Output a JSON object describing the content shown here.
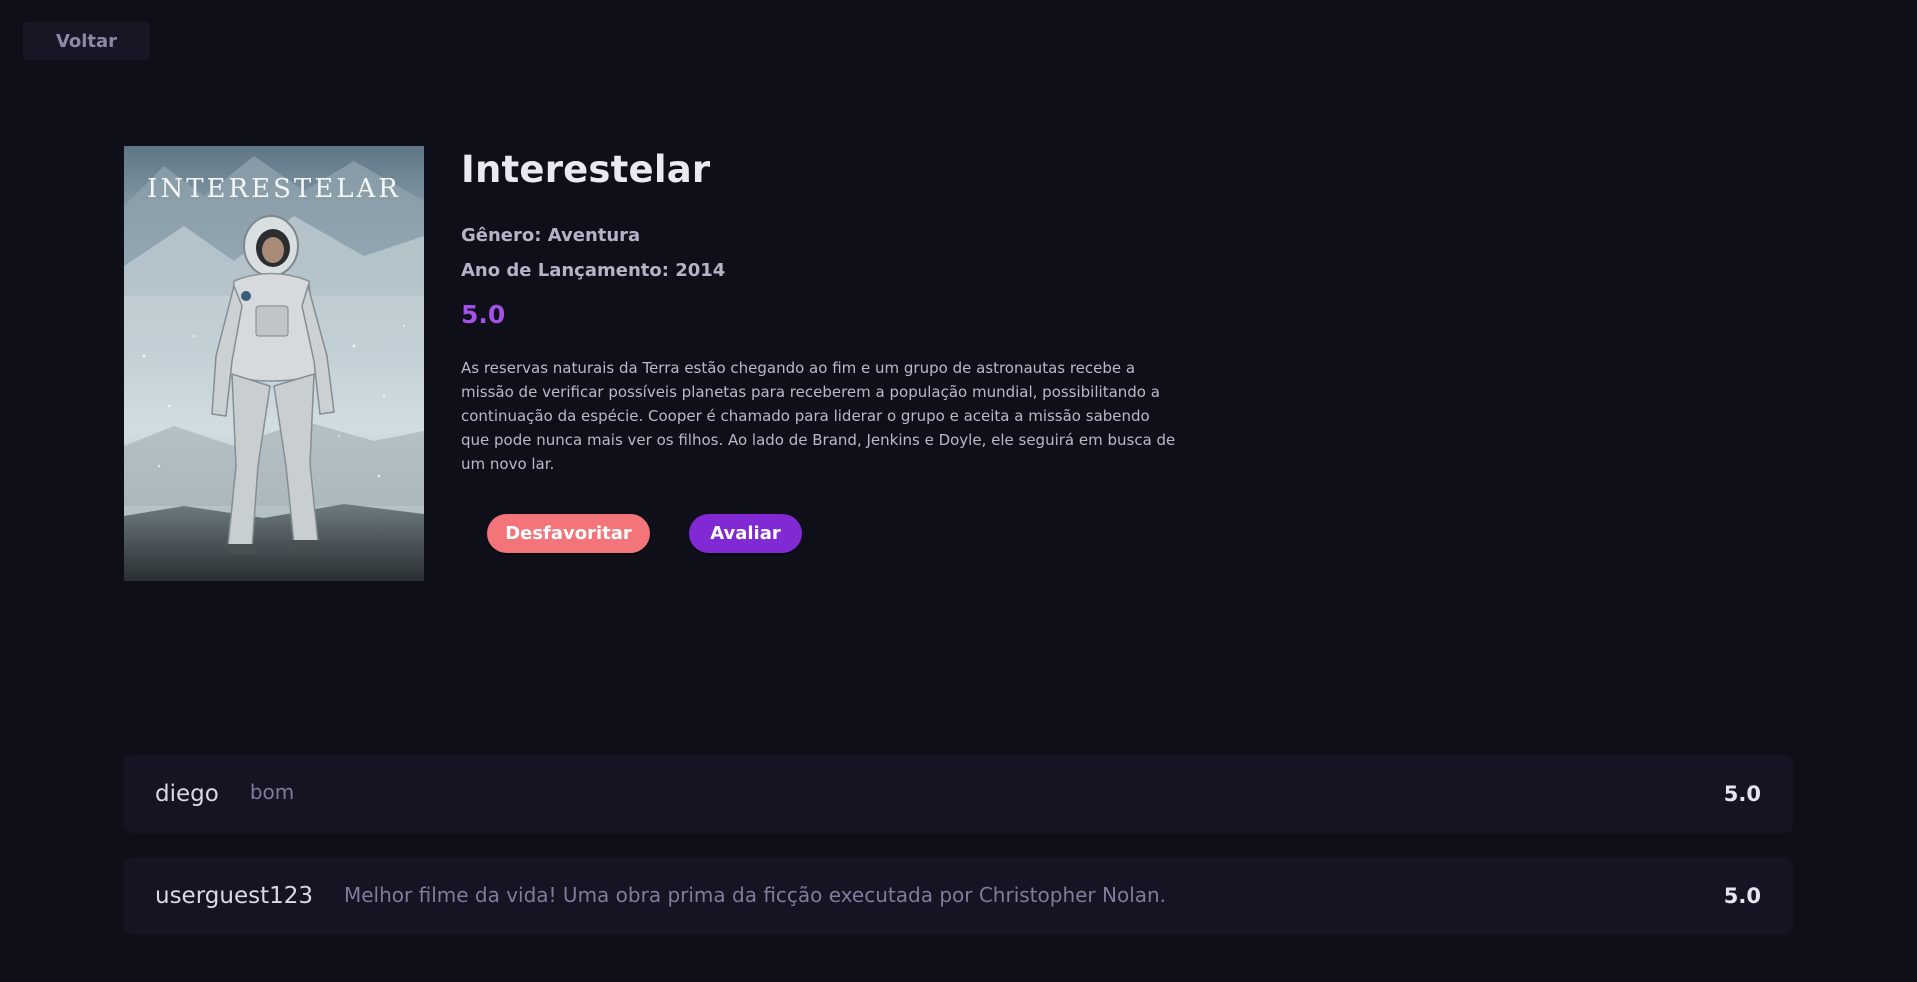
{
  "nav": {
    "back_label": "Voltar"
  },
  "movie": {
    "poster_text": "INTERESTELAR",
    "title": "Interestelar",
    "genre_text": "Gênero: Aventura",
    "year_text": "Ano de Lançamento: 2014",
    "rating": "5.0",
    "synopsis": "As reservas naturais da Terra estão chegando ao fim e um grupo de astronautas recebe a missão de verificar possíveis planetas para receberem a população mundial, possibilitando a continuação da espécie. Cooper é chamado para liderar o grupo e aceita a missão sabendo que pode nunca mais ver os filhos. Ao lado de Brand, Jenkins e Doyle, ele seguirá em busca de um novo lar."
  },
  "actions": {
    "unfavorite_label": "Desfavoritar",
    "rate_label": "Avaliar"
  },
  "reviews": [
    {
      "user": "diego",
      "comment": "bom",
      "score": "5.0"
    },
    {
      "user": "userguest123",
      "comment": "Melhor filme da vida! Uma obra prima da ficção executada por Christopher Nolan.",
      "score": "5.0"
    }
  ],
  "colors": {
    "background": "#0f0f1a",
    "accent_purple": "#8129d3",
    "rating_purple": "#a352e8",
    "unfavorite_pink": "#f37479",
    "card": "#141423"
  }
}
